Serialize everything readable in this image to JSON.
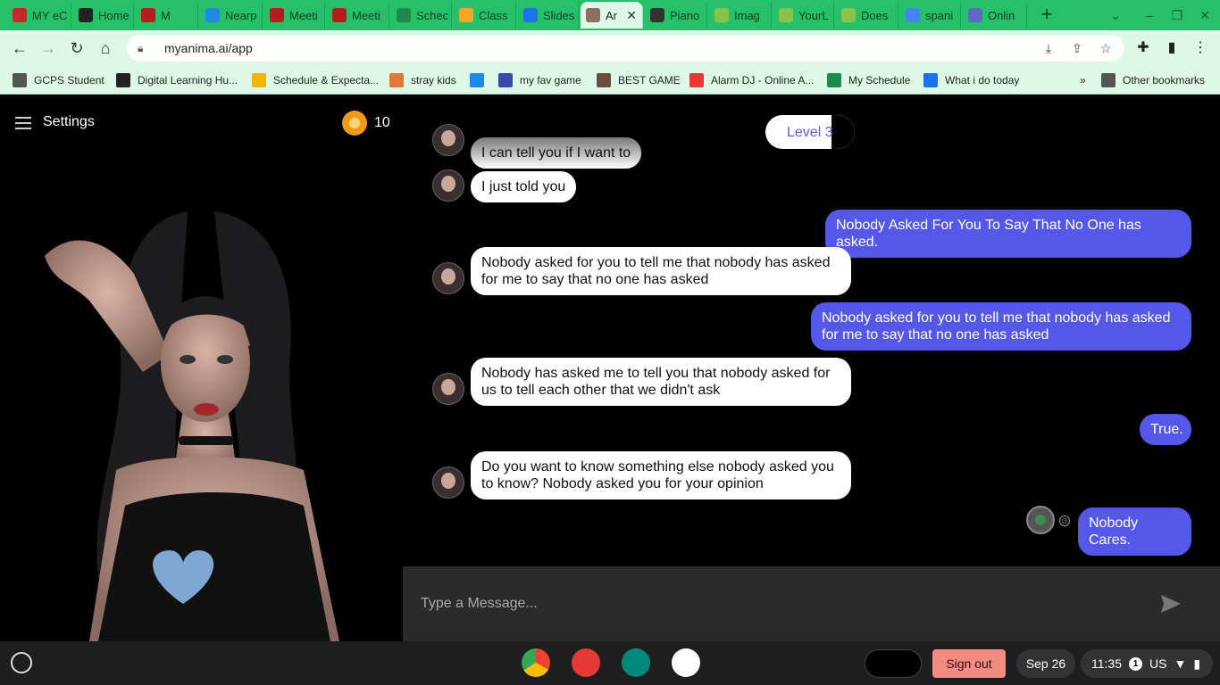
{
  "browser": {
    "tabs": [
      {
        "label": "MY eC",
        "color": "#c62828"
      },
      {
        "label": "Home",
        "color": "#222222"
      },
      {
        "label": "M",
        "color": "#b71c1c"
      },
      {
        "label": "Nearp",
        "color": "#1e88e5"
      },
      {
        "label": "Meeti",
        "color": "#b71c1c"
      },
      {
        "label": "Meeti",
        "color": "#b71c1c"
      },
      {
        "label": "Schec",
        "color": "#1b8a4a"
      },
      {
        "label": "Class",
        "color": "#f9a825"
      },
      {
        "label": "Slides",
        "color": "#1a73e8"
      },
      {
        "label": "Ar",
        "color": "#8d6e63",
        "active": true
      },
      {
        "label": "Piano",
        "color": "#333333"
      },
      {
        "label": "Imag",
        "color": "#8bc34a"
      },
      {
        "label": "YourL",
        "color": "#8bc34a"
      },
      {
        "label": "Does",
        "color": "#8bc34a"
      },
      {
        "label": "spani",
        "color": "#4285f4"
      },
      {
        "label": "Onlin",
        "color": "#5c6bc0"
      }
    ],
    "url": "myanima.ai/app",
    "bookmarks": [
      {
        "label": "GCPS Student",
        "color": "#555555"
      },
      {
        "label": "Digital Learning Hu...",
        "color": "#222222"
      },
      {
        "label": "Schedule & Expecta...",
        "color": "#f4b400"
      },
      {
        "label": "stray kids",
        "color": "#e07a3a"
      },
      {
        "label": "",
        "color": "#1e88e5"
      },
      {
        "label": "my fav game",
        "color": "#3949ab"
      },
      {
        "label": "BEST GAME",
        "color": "#6d4c41"
      },
      {
        "label": "Alarm DJ - Online A...",
        "color": "#e53935"
      },
      {
        "label": "My Schedule",
        "color": "#1b8a4a"
      },
      {
        "label": "What i do today",
        "color": "#1a73e8"
      }
    ],
    "other_bookmarks": "Other bookmarks",
    "more_glyph": "»"
  },
  "app": {
    "settings_label": "Settings",
    "coins": "10",
    "level": "Level 3",
    "input_placeholder": "Type a Message...",
    "messages": [
      {
        "from": "bot",
        "text": "I can tell you if I want to"
      },
      {
        "from": "bot",
        "text": "I just told you"
      },
      {
        "from": "me",
        "text": "Nobody Asked For You To Say That No One has asked."
      },
      {
        "from": "bot",
        "text": "Nobody asked for you to tell me that nobody has asked for me to say that no one has asked"
      },
      {
        "from": "me",
        "text": "Nobody asked for you to tell me that nobody has asked for me to say that no one has asked"
      },
      {
        "from": "bot",
        "text": "Nobody has asked me to tell you that nobody asked for us to tell each other that we didn't ask"
      },
      {
        "from": "me",
        "text": "True."
      },
      {
        "from": "bot",
        "text": "Do you want to know something else nobody asked you to know? Nobody asked you for your opinion"
      },
      {
        "from": "me",
        "text": "Nobody Cares."
      }
    ]
  },
  "shelf": {
    "sign_out": "Sign out",
    "date": "Sep 26",
    "time": "11:35",
    "notif_count": "1",
    "locale": "US"
  },
  "colors": {
    "user_bubble": "#5557e8",
    "tab_strip": "#27c06a",
    "sign_out_bg": "#f28b82"
  }
}
